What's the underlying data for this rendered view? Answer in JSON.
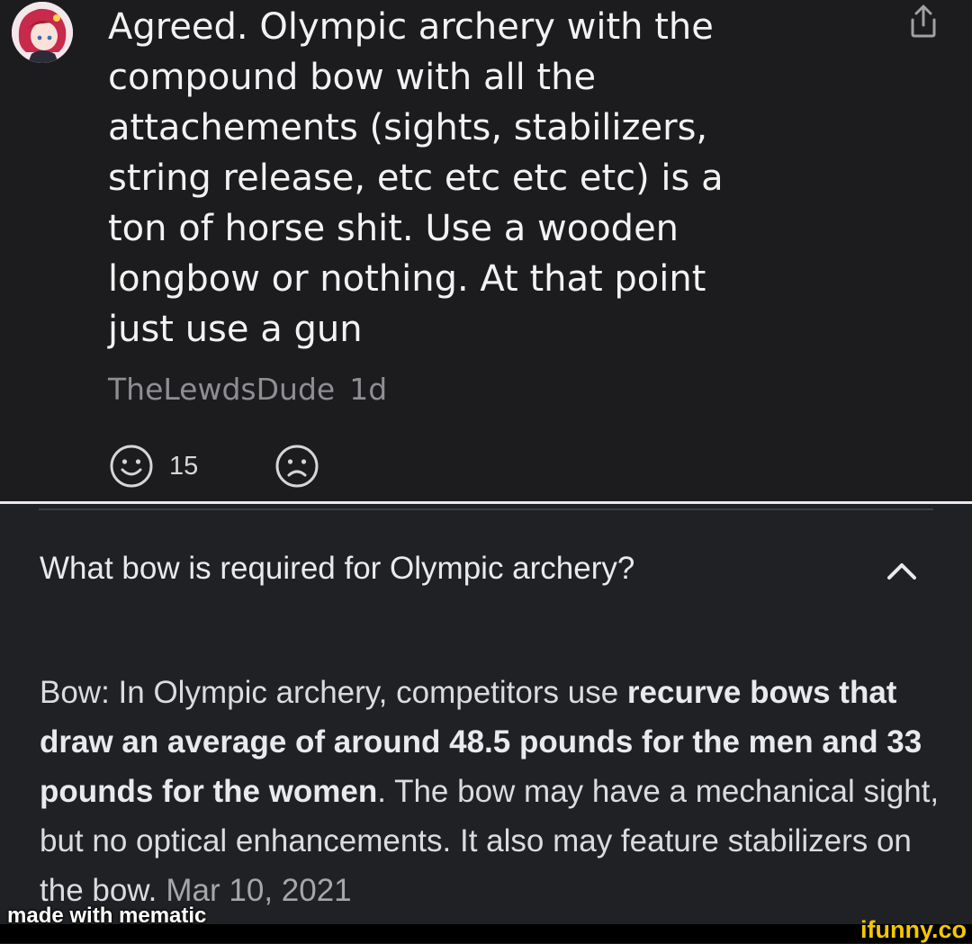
{
  "comment": {
    "text": "Agreed. Olympic archery with the\ncompound bow with all the\nattachements (sights, stabilizers,\nstring release, etc etc etc etc) is a\nton of horse shit. Use a wooden\nlongbow or nothing. At that point\njust use a gun",
    "username": "TheLewdsDude",
    "age": "1d",
    "upvotes": "15",
    "icons": {
      "share": "share-icon",
      "upvote": "smile-icon",
      "downvote": "frown-icon"
    }
  },
  "answer_card": {
    "question": "What bow is required for Olympic archery?",
    "answer_intro": "Bow: In Olympic archery, competitors use ",
    "answer_bold": "recurve bows that draw an average of around 48.5 pounds for the men and 33 pounds for the women",
    "answer_rest": ". The bow may have a mechanical sight, but no optical enhancements. It also may feature stabilizers on the bow.",
    "date": "Mar 10, 2021",
    "icons": {
      "collapse": "chevron-up-icon"
    }
  },
  "overlay": {
    "mematic_label": "made with mematic",
    "watermark": "ifunny.co"
  },
  "colors": {
    "comment_bg": "#1c1c1e",
    "answer_bg": "#202124",
    "watermark": "#f4c700"
  }
}
